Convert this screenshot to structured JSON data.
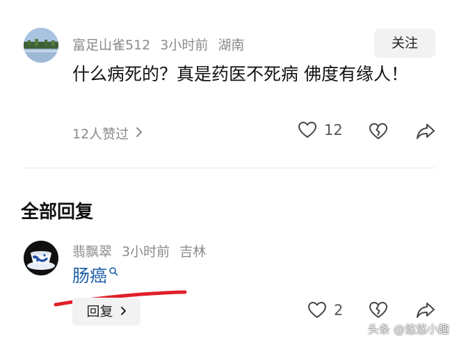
{
  "top_comment": {
    "username": "富足山雀512",
    "time": "3小时前",
    "location": "湖南",
    "follow_label": "关注",
    "text": "什么病死的？真是药医不死病 佛度有缘人！",
    "likes_text": "12人赞过",
    "like_count": "12"
  },
  "replies_section": {
    "title": "全部回复"
  },
  "reply": {
    "username": "翡飘翠",
    "time": "3小时前",
    "location": "吉林",
    "text": "肠癌",
    "reply_label": "回复",
    "like_count": "2"
  },
  "annotation": {
    "underline_color": "#e0202a"
  },
  "watermark": "头条 @悠悠小趣"
}
